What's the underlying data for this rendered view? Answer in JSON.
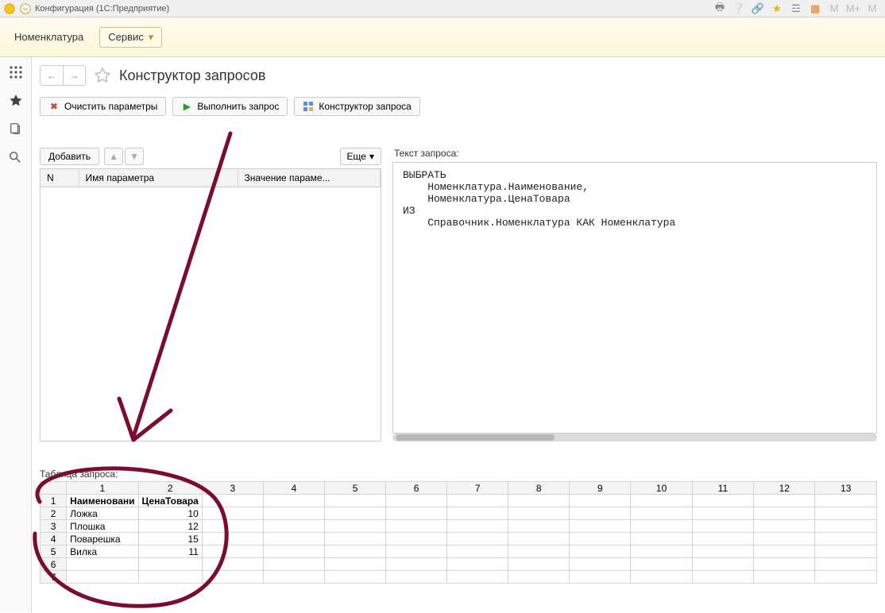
{
  "titlebar": {
    "title": "Конфигурация  (1С:Предприятие)"
  },
  "yellowbar": {
    "nomenclature": "Номенклатура",
    "service": "Сервис"
  },
  "page": {
    "title": "Конструктор запросов"
  },
  "actions": {
    "clear": "Очистить параметры",
    "run": "Выполнить запрос",
    "builder": "Конструктор запроса"
  },
  "params": {
    "add": "Добавить",
    "more": "Еще",
    "col_n": "N",
    "col_name": "Имя параметра",
    "col_value": "Значение параме..."
  },
  "query": {
    "label": "Текст запроса:",
    "text": "ВЫБРАТЬ\n    Номенклатура.Наименование,\n    Номенклатура.ЦенаТовара\nИЗ\n    Справочник.Номенклатура КАК Номенклатура"
  },
  "result": {
    "label": "Таблица запроса:",
    "col_headers_extra": [
      "3",
      "4",
      "5",
      "6",
      "7",
      "8",
      "9",
      "10",
      "11",
      "12",
      "13"
    ],
    "data_headers": [
      "Наименовани",
      "ЦенаТовара"
    ],
    "rows": [
      {
        "n": "2",
        "name": "Ложка",
        "price": "10"
      },
      {
        "n": "3",
        "name": "Плошка",
        "price": "12"
      },
      {
        "n": "4",
        "name": "Поварешка",
        "price": "15"
      },
      {
        "n": "5",
        "name": "Вилка",
        "price": "11"
      }
    ],
    "empty_rows": [
      "6",
      "7"
    ]
  }
}
